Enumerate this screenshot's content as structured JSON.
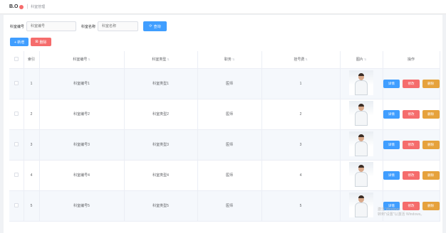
{
  "topbar": {
    "logo": "B.O",
    "separator": "|",
    "breadcrumb": "科室管理"
  },
  "search": {
    "field1_label": "科室编号",
    "field1_placeholder": "科室编号",
    "field2_label": "科室名称",
    "field2_placeholder": "科室名称",
    "button_label": "查询"
  },
  "toolbar": {
    "add_label": "+ 新增",
    "delete_label": "删除"
  },
  "table": {
    "headers": [
      "",
      "索引",
      "科室编号",
      "科室类型",
      "职务",
      "挂号费",
      "图片",
      "操作"
    ],
    "rows": [
      {
        "index": "1",
        "code": "科室编号1",
        "type": "科室类型1",
        "role": "医师",
        "fee": "1"
      },
      {
        "index": "2",
        "code": "科室编号2",
        "type": "科室类型2",
        "role": "医师",
        "fee": "2"
      },
      {
        "index": "3",
        "code": "科室编号3",
        "type": "科室类型3",
        "role": "医师",
        "fee": "3"
      },
      {
        "index": "4",
        "code": "科室编号4",
        "type": "科室类型4",
        "role": "医师",
        "fee": "4"
      },
      {
        "index": "5",
        "code": "科室编号5",
        "type": "科室类型5",
        "role": "医师",
        "fee": "5"
      }
    ],
    "op_detail": "详情",
    "op_edit": "修改",
    "op_delete": "删除"
  },
  "watermark": {
    "line1": "激活 Windows",
    "line2": "转到\"设置\"以激活 Windows。"
  },
  "colors": {
    "primary": "#409eff",
    "danger": "#f56c6c",
    "warning": "#e6a23c"
  }
}
